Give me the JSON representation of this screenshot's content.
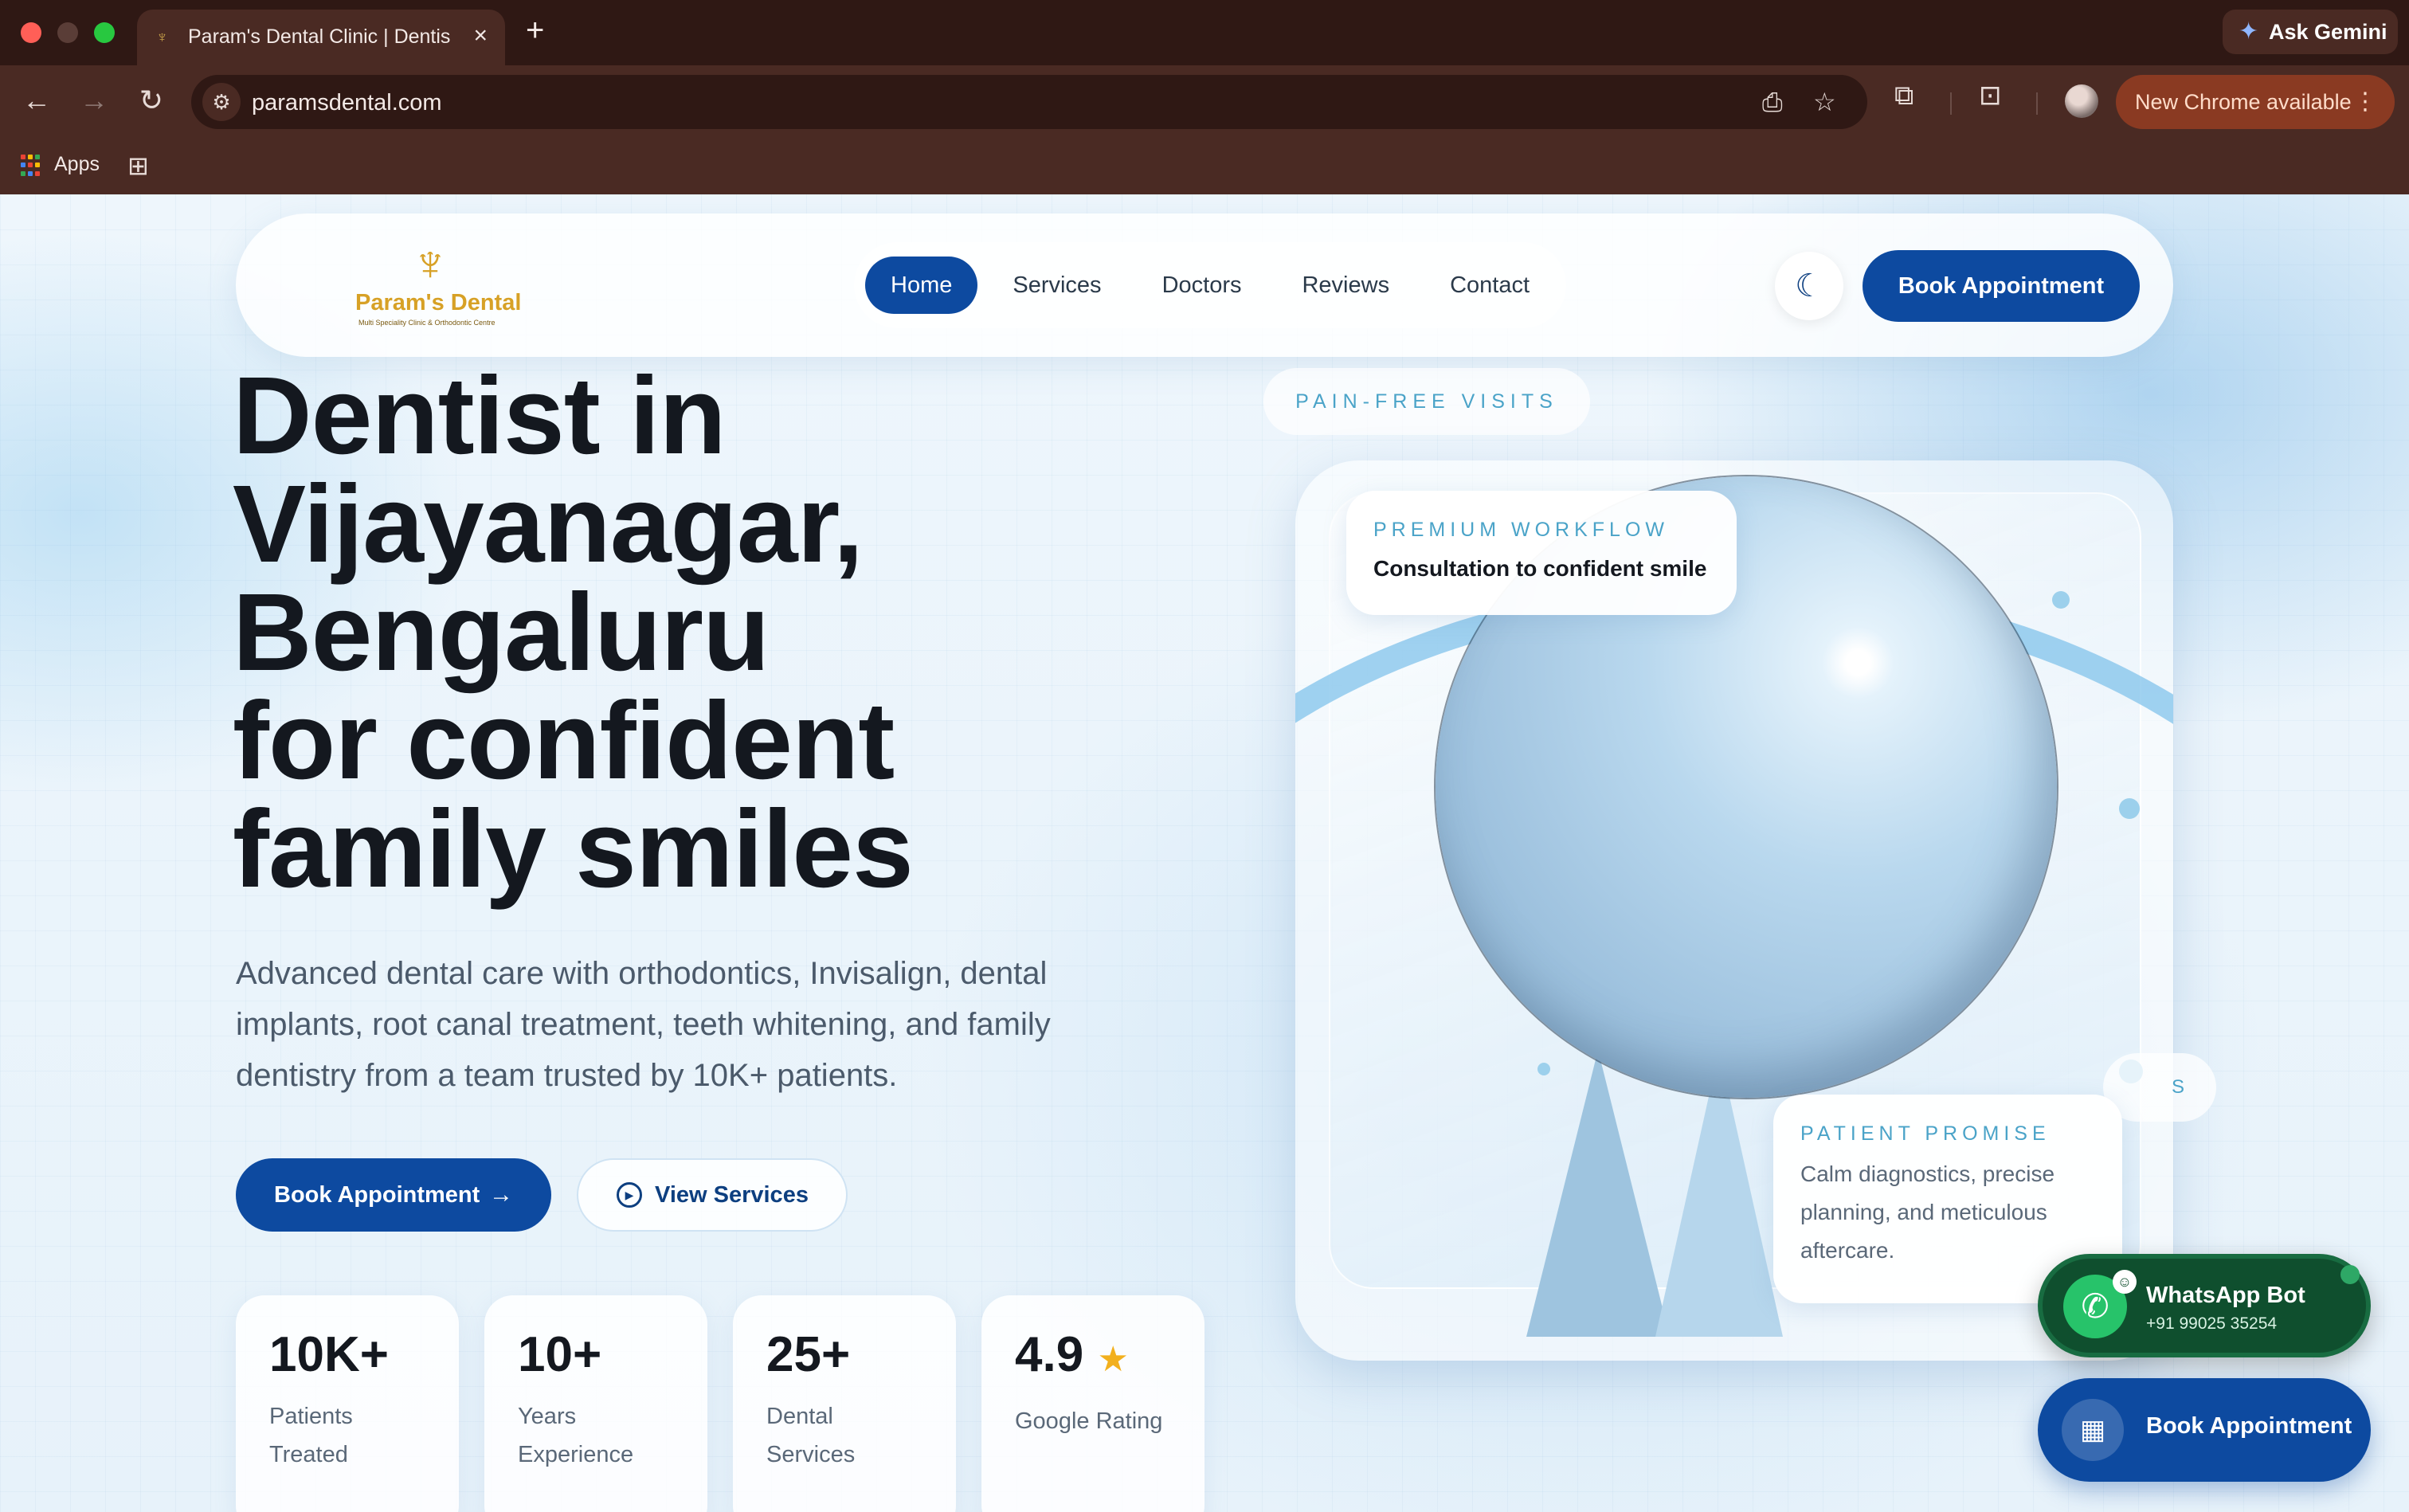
{
  "browser": {
    "tab_title": "Param's Dental Clinic | Dentis",
    "tab_close": "×",
    "new_tab": "+",
    "gemini_label": "Ask Gemini",
    "url": "paramsdental.com",
    "update_label": "New Chrome available",
    "bookmark_apps": "Apps"
  },
  "site": {
    "logo_name": "Param's Dental",
    "logo_tagline": "Multi Speciality Clinic & Orthodontic Centre",
    "nav": [
      "Home",
      "Services",
      "Doctors",
      "Reviews",
      "Contact"
    ],
    "nav_active": "Home",
    "nav_cta": "Book Appointment"
  },
  "hero": {
    "title_lines": [
      "Dentist in",
      "Vijayanagar,",
      "Bengaluru",
      "for confident",
      "family smiles"
    ],
    "description": "Advanced dental care with orthodontics, Invisalign, dental implants, root canal treatment, teeth whitening, and family dentistry from a team trusted by 10K+ patients.",
    "primary_cta": "Book Appointment",
    "secondary_cta": "View Services"
  },
  "stats": [
    {
      "value": "10K+",
      "label": "Patients Treated"
    },
    {
      "value": "10+",
      "label": "Years Experience"
    },
    {
      "value": "25+",
      "label": "Dental Services"
    },
    {
      "value": "4.9",
      "label": "Google Rating"
    }
  ],
  "visual": {
    "tag": "PAIN-FREE VISITS",
    "top_eyebrow": "PREMIUM WORKFLOW",
    "top_text": "Consultation to confident smile",
    "bottom_eyebrow": "PATIENT PROMISE",
    "bottom_text": "Calm diagnostics, precise planning, and meticulous aftercare.",
    "side_pill": "S"
  },
  "floating": {
    "whatsapp_title": "WhatsApp Bot",
    "whatsapp_number": "+91 99025 35254",
    "book_label": "Book Appointment"
  },
  "colors": {
    "brand_blue": "#0d4aa0",
    "accent_teal": "#4aa3c8",
    "whatsapp_green": "#27c36a",
    "logo_gold": "#d7a126"
  }
}
